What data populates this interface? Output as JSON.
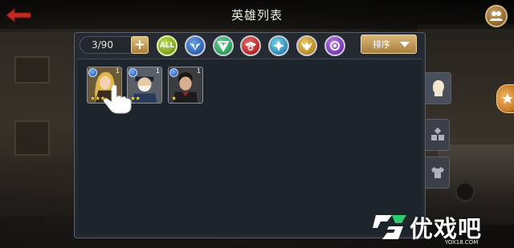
{
  "header": {
    "title": "英雄列表"
  },
  "toolbar": {
    "hero_count": "3/90",
    "add_label": "+",
    "filters": [
      {
        "id": "all",
        "label": "ALL",
        "color": "#8ab42a"
      },
      {
        "id": "faction-blue",
        "icon": "wings-shield-icon",
        "color": "#2c5fb0"
      },
      {
        "id": "faction-green",
        "icon": "v-shield-icon",
        "color": "#2a9a5a"
      },
      {
        "id": "faction-red",
        "icon": "eagle-icon",
        "color": "#b52626"
      },
      {
        "id": "faction-cyan",
        "icon": "star-burst-icon",
        "color": "#2a8ab6"
      },
      {
        "id": "faction-gold",
        "icon": "winged-emblem-icon",
        "color": "#b88a22"
      },
      {
        "id": "faction-purple",
        "icon": "orb-icon",
        "color": "#7a36b4"
      }
    ],
    "sort_label": "排序"
  },
  "heroes": [
    {
      "name_icon": "blonde-heroine-portrait",
      "level": "1",
      "stars": "★★★",
      "star_count": 3
    },
    {
      "name_icon": "bearded-hero-portrait",
      "level": "1",
      "stars": "★★",
      "star_count": 2
    },
    {
      "name_icon": "dark-haired-hero-portrait",
      "level": "1",
      "stars": "★",
      "star_count": 1
    }
  ],
  "side_tabs": [
    {
      "id": "portrait",
      "icon": "head-silhouette-icon",
      "active": true
    },
    {
      "id": "pieces",
      "icon": "shards-icon",
      "active": false
    },
    {
      "id": "gear",
      "icon": "shirt-icon",
      "active": false
    }
  ],
  "watermark": {
    "text": "优戏吧",
    "url": "YOX18.COM"
  },
  "colors": {
    "accent_gold": "#c9a263",
    "panel_bg": "#262b34"
  }
}
